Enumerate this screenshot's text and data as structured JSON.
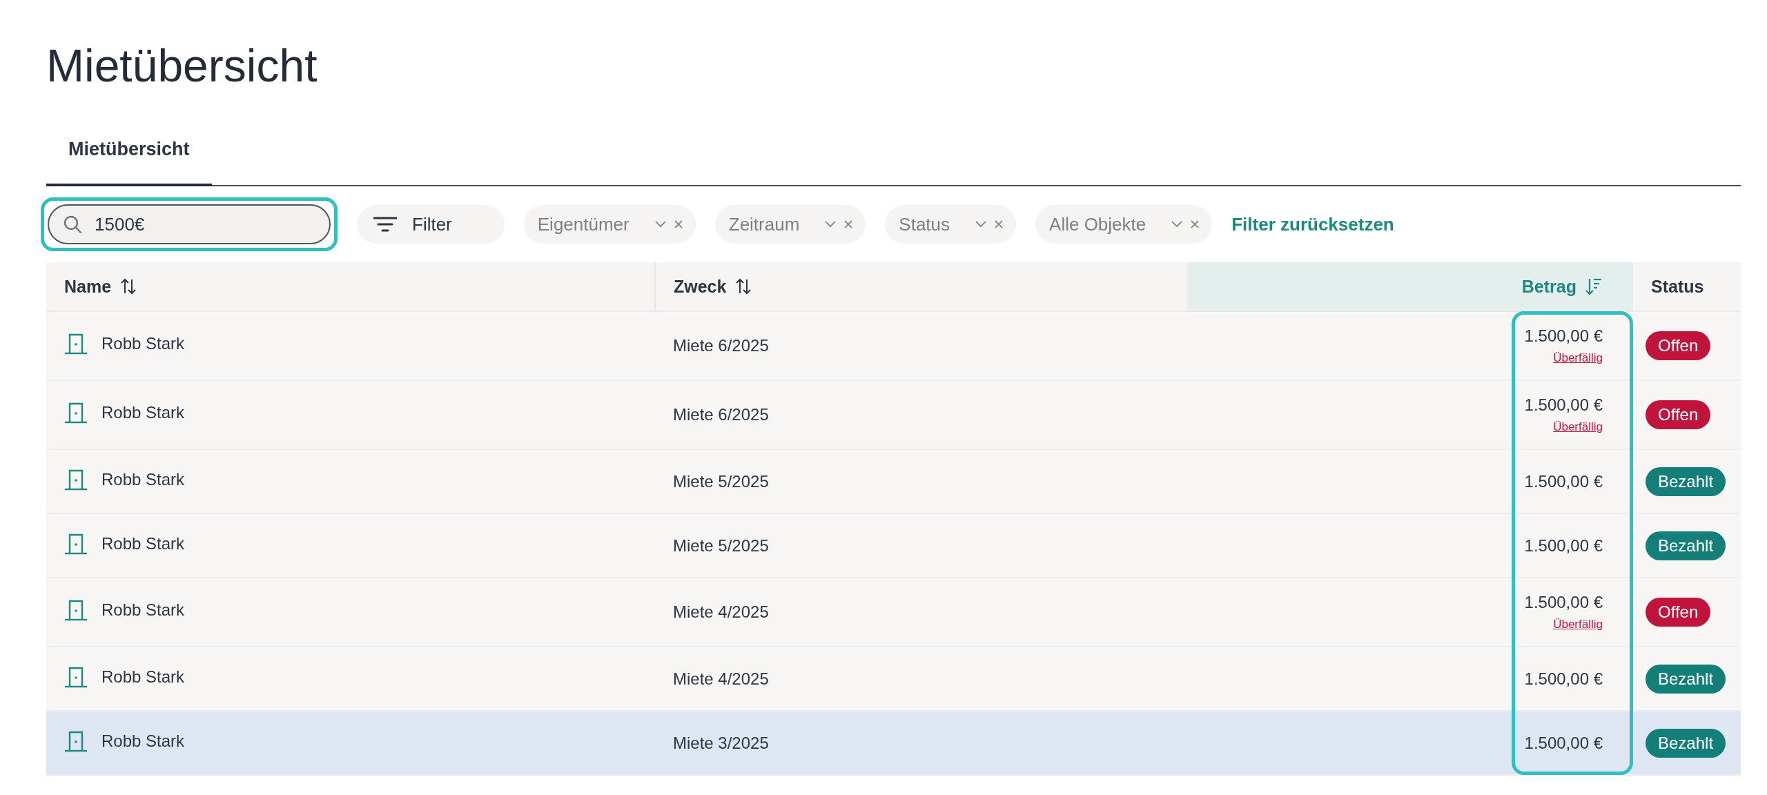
{
  "page_title": "Mietübersicht",
  "tabs": [
    {
      "label": "Mietübersicht",
      "selected": true
    }
  ],
  "search": {
    "value": "1500€",
    "highlighted": true
  },
  "filter_button": {
    "label": "Filter"
  },
  "filter_chips": [
    {
      "label": "Eigentümer"
    },
    {
      "label": "Zeitraum"
    },
    {
      "label": "Status"
    },
    {
      "label": "Alle Objekte"
    }
  ],
  "reset_link": "Filter zurücksetzen",
  "table": {
    "columns": [
      {
        "label": "Name",
        "kind": "text",
        "sortable": true,
        "sorted": false,
        "selected": false
      },
      {
        "label": "Zweck",
        "kind": "text",
        "sortable": true,
        "sorted": false,
        "selected": false
      },
      {
        "label": "Betrag",
        "kind": "amount",
        "sortable": true,
        "sorted": true,
        "selected": true,
        "highlighted": true
      },
      {
        "label": "Status",
        "kind": "status",
        "sortable": false,
        "selected": false
      }
    ],
    "rows": [
      {
        "name": "Robb Stark",
        "purpose": "Miete 6/2025",
        "amount": "1.500,00 €",
        "note": "Überfällig",
        "status": "Offen",
        "color": "#c0143c",
        "selected": false
      },
      {
        "name": "Robb Stark",
        "purpose": "Miete 6/2025",
        "amount": "1.500,00 €",
        "note": "Überfällig",
        "status": "Offen",
        "color": "#c0143c",
        "selected": false
      },
      {
        "name": "Robb Stark",
        "purpose": "Miete 5/2025",
        "amount": "1.500,00 €",
        "status": "Bezahlt",
        "color": "#137f78",
        "selected": false
      },
      {
        "name": "Robb Stark",
        "purpose": "Miete 5/2025",
        "amount": "1.500,00 €",
        "status": "Bezahlt",
        "color": "#137f78",
        "selected": false
      },
      {
        "name": "Robb Stark",
        "purpose": "Miete 4/2025",
        "amount": "1.500,00 €",
        "note": "Überfällig",
        "status": "Offen",
        "color": "#c0143c",
        "selected": false
      },
      {
        "name": "Robb Stark",
        "purpose": "Miete 4/2025",
        "amount": "1.500,00 €",
        "status": "Bezahlt",
        "color": "#137f78",
        "selected": false
      },
      {
        "name": "Robb Stark",
        "purpose": "Miete 3/2025",
        "amount": "1.500,00 €",
        "status": "Bezahlt",
        "color": "#137f78",
        "selected": true
      }
    ]
  }
}
